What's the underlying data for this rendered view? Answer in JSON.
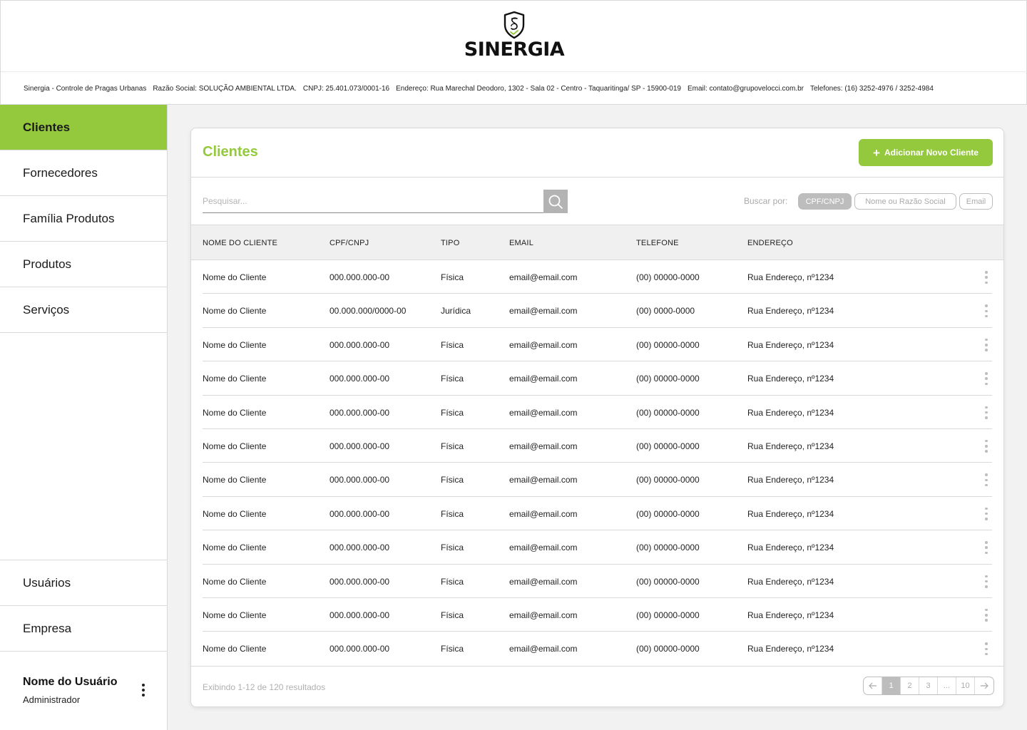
{
  "header": {
    "logo_text": "SINERGIA",
    "company_info": [
      "Sinergia - Controle de Pragas Urbanas",
      "Razão Social: SOLUÇÃO AMBIENTAL LTDA.",
      "CNPJ: 25.401.073/0001-16",
      "Endereço: Rua Marechal Deodoro, 1302 - Sala 02 - Centro - Taquaritinga/ SP - 15900-019",
      "Email: contato@grupovelocci.com.br",
      "Telefones: (16) 3252-4976 / 3252-4984"
    ]
  },
  "sidebar": {
    "items": [
      {
        "label": "Clientes",
        "active": true
      },
      {
        "label": "Fornecedores"
      },
      {
        "label": "Família Produtos"
      },
      {
        "label": "Produtos"
      },
      {
        "label": "Serviços"
      }
    ],
    "bottom_items": [
      {
        "label": "Usuários"
      },
      {
        "label": "Empresa"
      }
    ],
    "user": {
      "name": "Nome do Usuário",
      "role": "Administrador"
    }
  },
  "main": {
    "title": "Clientes",
    "add_button": "Adicionar Novo Cliente",
    "search": {
      "placeholder": "Pesquisar..."
    },
    "filter": {
      "label": "Buscar por:",
      "options": [
        "CPF/CNPJ",
        "Nome ou Razão Social",
        "Email"
      ],
      "selected": "CPF/CNPJ"
    },
    "table": {
      "columns": [
        "NOME DO CLIENTE",
        "CPF/CNPJ",
        "TIPO",
        "EMAIL",
        "TELEFONE",
        "ENDEREÇO"
      ],
      "rows": [
        [
          "Nome do Cliente",
          "000.000.000-00",
          "Física",
          "email@email.com",
          "(00) 00000-0000",
          "Rua Endereço, nº1234"
        ],
        [
          "Nome do Cliente",
          "00.000.000/0000-00",
          "Jurídica",
          "email@email.com",
          "(00) 0000-0000",
          "Rua Endereço, nº1234"
        ],
        [
          "Nome do Cliente",
          "000.000.000-00",
          "Física",
          "email@email.com",
          "(00) 00000-0000",
          "Rua Endereço, nº1234"
        ],
        [
          "Nome do Cliente",
          "000.000.000-00",
          "Física",
          "email@email.com",
          "(00) 00000-0000",
          "Rua Endereço, nº1234"
        ],
        [
          "Nome do Cliente",
          "000.000.000-00",
          "Física",
          "email@email.com",
          "(00) 00000-0000",
          "Rua Endereço, nº1234"
        ],
        [
          "Nome do Cliente",
          "000.000.000-00",
          "Física",
          "email@email.com",
          "(00) 00000-0000",
          "Rua Endereço, nº1234"
        ],
        [
          "Nome do Cliente",
          "000.000.000-00",
          "Física",
          "email@email.com",
          "(00) 00000-0000",
          "Rua Endereço, nº1234"
        ],
        [
          "Nome do Cliente",
          "000.000.000-00",
          "Física",
          "email@email.com",
          "(00) 00000-0000",
          "Rua Endereço, nº1234"
        ],
        [
          "Nome do Cliente",
          "000.000.000-00",
          "Física",
          "email@email.com",
          "(00) 00000-0000",
          "Rua Endereço, nº1234"
        ],
        [
          "Nome do Cliente",
          "000.000.000-00",
          "Física",
          "email@email.com",
          "(00) 00000-0000",
          "Rua Endereço, nº1234"
        ],
        [
          "Nome do Cliente",
          "000.000.000-00",
          "Física",
          "email@email.com",
          "(00) 00000-0000",
          "Rua Endereço, nº1234"
        ],
        [
          "Nome do Cliente",
          "000.000.000-00",
          "Física",
          "email@email.com",
          "(00) 00000-0000",
          "Rua Endereço, nº1234"
        ]
      ]
    },
    "footer": {
      "results_text": "Exibindo 1-12 de 120 resultados",
      "pages": [
        "1",
        "2",
        "3",
        "...",
        "10"
      ],
      "current_page": "1"
    }
  },
  "colors": {
    "accent": "#95c93d",
    "muted": "#bdbdbd"
  },
  "icons": {
    "search": "search-icon",
    "row_menu": "more-vertical-icon",
    "prev": "arrow-left-icon",
    "next": "arrow-right-icon",
    "add": "plus-icon"
  }
}
